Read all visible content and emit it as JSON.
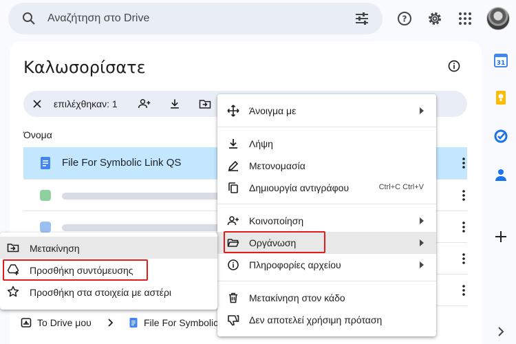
{
  "search": {
    "placeholder": "Αναζήτηση στο Drive"
  },
  "main": {
    "title": "Καλωσορίσατε",
    "selection_count": "επιλέχθηκαν: 1",
    "column_header": "Όνομα",
    "selected_file": "File For Symbolic Link QS"
  },
  "breadcrumb": {
    "root": "Το Drive μου",
    "current": "File For Symbolic"
  },
  "context_menu": {
    "items": [
      {
        "label": "Άνοιγμα με",
        "icon": "move-arrows-icon",
        "submenu": true
      },
      {
        "label": "Λήψη",
        "icon": "download-icon"
      },
      {
        "label": "Μετονομασία",
        "icon": "rename-icon"
      },
      {
        "label": "Δημιουργία αντιγράφου",
        "icon": "copy-icon",
        "shortcut": "Ctrl+C Ctrl+V"
      },
      {
        "label": "Κοινοποίηση",
        "icon": "person-add-icon",
        "submenu": true
      },
      {
        "label": "Οργάνωση",
        "icon": "folder-open-icon",
        "submenu": true,
        "highlighted": true
      },
      {
        "label": "Πληροφορίες αρχείου",
        "icon": "info-icon",
        "submenu": true
      },
      {
        "label": "Μετακίνηση στον κάδο",
        "icon": "trash-icon"
      },
      {
        "label": "Δεν αποτελεί χρήσιμη πρόταση",
        "icon": "thumb-down-icon"
      }
    ]
  },
  "organize_submenu": {
    "items": [
      {
        "label": "Μετακίνηση",
        "icon": "move-folder-icon",
        "highlighted": true
      },
      {
        "label": "Προσθήκη συντόμευσης",
        "icon": "add-shortcut-icon"
      },
      {
        "label": "Προσθήκη στα στοιχεία με αστέρι",
        "icon": "star-icon"
      }
    ]
  },
  "colors": {
    "selected_row": "#c2e7ff",
    "highlight_box": "#e01b1b",
    "search_bg": "#e9eef6"
  }
}
